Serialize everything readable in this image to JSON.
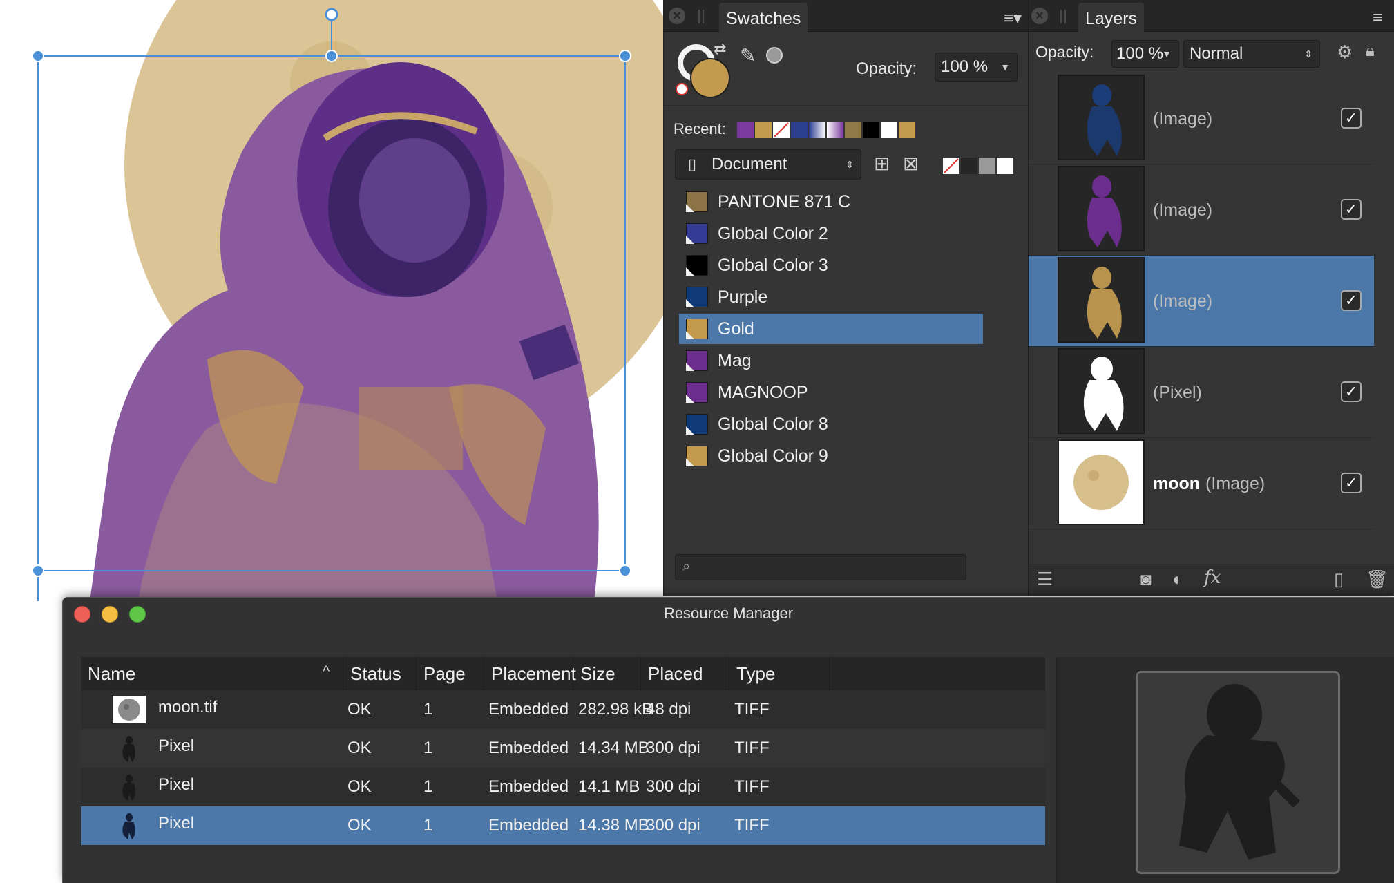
{
  "swatches_panel": {
    "tab_label": "Swatches",
    "opacity_label": "Opacity:",
    "opacity_value": "100 %",
    "recent_label": "Recent:",
    "recent_colors": [
      "#7b3a9e",
      "#c49a4e",
      "none",
      "#2b3e8f",
      "gradient-blue",
      "gradient-purple",
      "#8f7a48",
      "#000000",
      "#ffffff",
      "#c49a4e"
    ],
    "palette_dropdown": "Document",
    "swatches": [
      {
        "label": "PANTONE 871 C",
        "color": "#8c7446"
      },
      {
        "label": "Global Color 2",
        "color": "#343b94"
      },
      {
        "label": "Global Color 3",
        "color": "#000000"
      },
      {
        "label": "Purple",
        "color": "#0e3a78"
      },
      {
        "label": "Gold",
        "color": "#c49a4e",
        "selected": true
      },
      {
        "label": "Mag",
        "color": "#6b2e8c"
      },
      {
        "label": "MAGNOOP",
        "color": "#6b2e8c"
      },
      {
        "label": "Global Color 8",
        "color": "#0e3a78"
      },
      {
        "label": "Global Color 9",
        "color": "#c49a4e"
      }
    ],
    "search_placeholder": ""
  },
  "layers_panel": {
    "tab_label": "Layers",
    "opacity_label": "Opacity:",
    "opacity_value": "100 %",
    "blend_mode": "Normal",
    "layers": [
      {
        "name": "",
        "type": "(Image)",
        "thumb": "astronaut-blue",
        "visible": true
      },
      {
        "name": "",
        "type": "(Image)",
        "thumb": "astronaut-purple",
        "visible": true
      },
      {
        "name": "",
        "type": "(Image)",
        "thumb": "astronaut-gold",
        "visible": true,
        "selected": true
      },
      {
        "name": "",
        "type": "(Pixel)",
        "thumb": "astronaut-white",
        "visible": true
      },
      {
        "name": "moon",
        "type": "(Image)",
        "thumb": "moon",
        "visible": true
      }
    ]
  },
  "resource_manager": {
    "title": "Resource Manager",
    "columns": [
      "Name",
      "Status",
      "Page",
      "Placement",
      "Size",
      "Placed DPI",
      "Type"
    ],
    "rows": [
      {
        "name": "moon.tif",
        "status": "OK",
        "page": "1",
        "placement": "Embedded",
        "size": "282.98 kB",
        "dpi": "48 dpi",
        "type": "TIFF",
        "thumb": "moon"
      },
      {
        "name": "Pixel",
        "status": "OK",
        "page": "1",
        "placement": "Embedded",
        "size": "14.34 MB",
        "dpi": "300 dpi",
        "type": "TIFF",
        "thumb": "astronaut"
      },
      {
        "name": "Pixel",
        "status": "OK",
        "page": "1",
        "placement": "Embedded",
        "size": "14.1 MB",
        "dpi": "300 dpi",
        "type": "TIFF",
        "thumb": "astronaut"
      },
      {
        "name": "Pixel",
        "status": "OK",
        "page": "1",
        "placement": "Embedded",
        "size": "14.38 MB",
        "dpi": "300 dpi",
        "type": "TIFF",
        "thumb": "astronaut",
        "selected": true
      }
    ]
  },
  "colors": {
    "panel_bg": "#353535",
    "selection": "#4b78a8",
    "gold": "#c49a4e",
    "purple": "#6b2e8c",
    "moon": "#d7bf8c"
  }
}
